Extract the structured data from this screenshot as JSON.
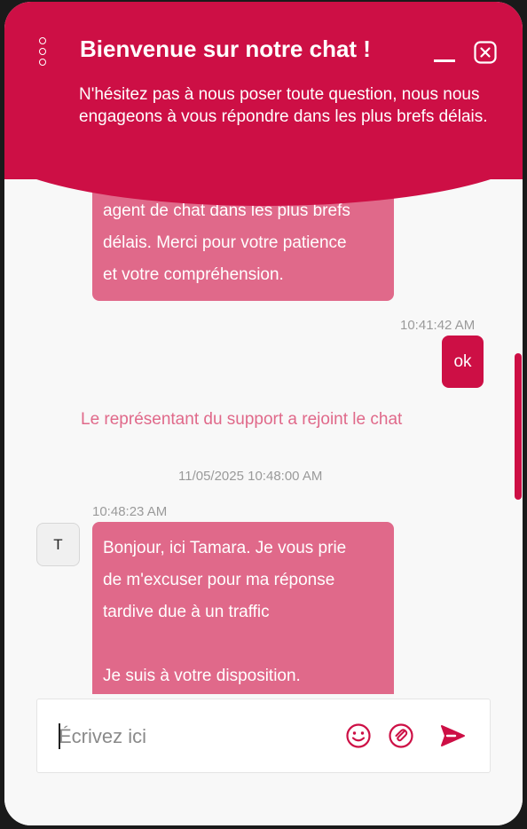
{
  "header": {
    "title": "Bienvenue sur notre chat !",
    "subtitle": "N'hésitez pas à nous poser toute question, nous nous engageons à vous répondre dans les plus brefs délais."
  },
  "messages": {
    "top_bubble_lines": [
      "agent de chat dans les plus brefs",
      "délais. Merci pour votre patience",
      "et votre compréhension."
    ],
    "user_timestamp": "10:41:42 AM",
    "user_message": "ok",
    "system_message": "Le représentant du support a rejoint le chat",
    "system_timestamp": "11/05/2025 10:48:00 AM",
    "agent_timestamp": "10:48:23 AM",
    "agent_avatar_initial": "T",
    "agent_lines": [
      "Bonjour, ici Tamara. Je vous prie",
      "de m'excuser pour ma réponse",
      "tardive due à un traffic",
      "",
      "Je suis à votre disposition."
    ]
  },
  "composer": {
    "placeholder": "Écrivez ici",
    "value": ""
  },
  "icons": {
    "menu": "vertical-dots-icon",
    "minimize": "minimize-icon",
    "close": "close-icon",
    "emoji": "emoji-icon",
    "attach": "attachment-icon",
    "send": "send-icon"
  },
  "colors": {
    "brand": "#cd0f45",
    "bubble": "#e0698a",
    "timestamp": "#9a9a9a"
  }
}
